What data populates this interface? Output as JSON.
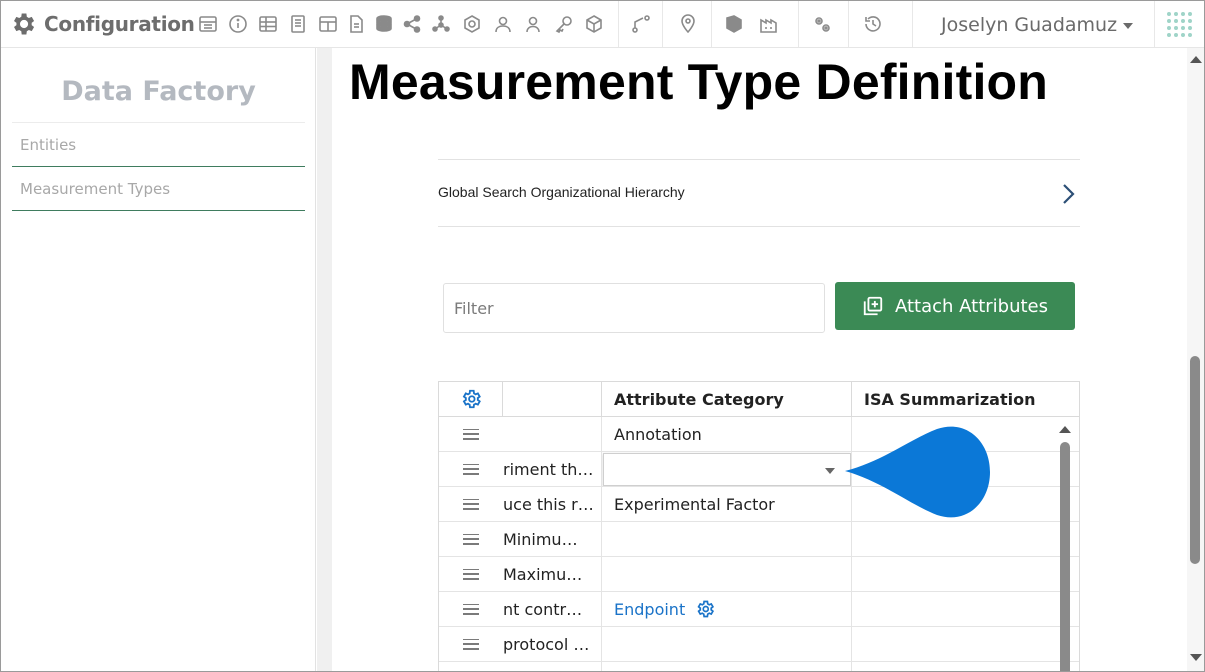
{
  "app": {
    "title": "Configuration",
    "user_name": "Joselyn Guadamuz"
  },
  "toolbar_icons": [
    "dashboard-icon",
    "info-icon",
    "table-icon",
    "book-icon",
    "grid-table-icon",
    "document-icon",
    "database-icon",
    "share-icon",
    "network-icon",
    "badge-icon",
    "user-group-icon",
    "user-icon",
    "key-icon",
    "cube-icon",
    "workflow-icon",
    "location-pin-icon",
    "tag-icon",
    "factory-icon",
    "settings-icon",
    "history-icon",
    "apps-grid-icon"
  ],
  "sidebar": {
    "title": "Data Factory",
    "items": [
      {
        "label": "Entities"
      },
      {
        "label": "Measurement Types"
      }
    ]
  },
  "main": {
    "page_title": "Measurement Type Definition",
    "hierarchy_label": "Global Search Organizational Hierarchy",
    "filter_placeholder": "Filter",
    "attach_button_label": "Attach Attributes"
  },
  "grid": {
    "columns": [
      {
        "label": ""
      },
      {
        "label": "Attribute Category"
      },
      {
        "label": "ISA Summarization"
      }
    ],
    "rows": [
      {
        "name": "",
        "category": "Annotation",
        "isa": ""
      },
      {
        "name": "riment th…",
        "category": "",
        "isa": "",
        "editing": true
      },
      {
        "name": "uce this r…",
        "category": "Experimental Factor",
        "isa": ""
      },
      {
        "name": " Minimu…",
        "category": "",
        "isa": ""
      },
      {
        "name": "Maximu…",
        "category": "",
        "isa": ""
      },
      {
        "name": "nt contr…",
        "category": "Endpoint",
        "isa": "",
        "category_is_link": true
      },
      {
        "name": "protocol …",
        "category": "",
        "isa": ""
      },
      {
        "name": "",
        "category": "",
        "isa": ""
      }
    ]
  },
  "colors": {
    "accent_green": "#3b8a55",
    "sidebar_underline": "#3f7c5e",
    "link_blue": "#1a73c8",
    "pointer_blue": "#0b78d7"
  }
}
